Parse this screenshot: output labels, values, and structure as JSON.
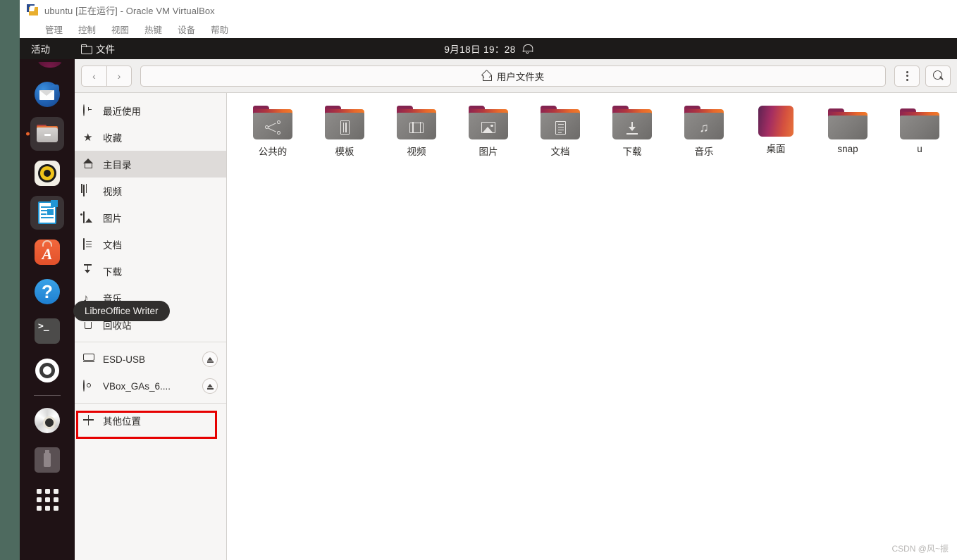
{
  "host": {
    "window_title": "ubuntu [正在运行] - Oracle VM VirtualBox",
    "menus": [
      "管理",
      "控制",
      "视图",
      "热键",
      "设备",
      "帮助"
    ]
  },
  "panel": {
    "activities": "活动",
    "app_name": "文件",
    "clock": "9月18日  19：28",
    "folder_icon": "folder-icon",
    "bell_icon": "bell-icon"
  },
  "dock": {
    "items": [
      {
        "name": "thunderbird",
        "label": "Thunderbird 邮件",
        "running": false
      },
      {
        "name": "files",
        "label": "文件",
        "running": true
      },
      {
        "name": "rhythmbox",
        "label": "Rhythmbox",
        "running": false
      },
      {
        "name": "libreoffice-writer",
        "label": "LibreOffice Writer",
        "running": false
      },
      {
        "name": "ubuntu-software",
        "label": "Ubuntu 软件",
        "running": false
      },
      {
        "name": "help",
        "label": "帮助",
        "running": false
      },
      {
        "name": "terminal",
        "label": "终端",
        "running": false
      },
      {
        "name": "settings",
        "label": "设置",
        "running": false
      },
      {
        "name": "cdrom",
        "label": "VBox_GAs_6....",
        "running": false
      },
      {
        "name": "usb-drive",
        "label": "ESD-USB",
        "running": false
      },
      {
        "name": "show-applications",
        "label": "显示应用程序",
        "running": false
      }
    ]
  },
  "tooltip": {
    "text": "LibreOffice Writer"
  },
  "headerbar": {
    "back_label": "‹",
    "forward_label": "›",
    "path_label": "用户文件夹",
    "home_icon": "home-icon",
    "menu_icon": "kebab-menu-icon",
    "search_icon": "search-icon"
  },
  "sidebar": {
    "groups": [
      {
        "items": [
          {
            "label": "最近使用",
            "icon": "clock-icon",
            "selected": false,
            "eject": false
          },
          {
            "label": "收藏",
            "icon": "star-icon",
            "selected": false,
            "eject": false
          },
          {
            "label": "主目录",
            "icon": "home-icon",
            "selected": true,
            "eject": false
          },
          {
            "label": "视频",
            "icon": "film-icon",
            "selected": false,
            "eject": false
          },
          {
            "label": "图片",
            "icon": "picture-icon",
            "selected": false,
            "eject": false
          },
          {
            "label": "文档",
            "icon": "document-icon",
            "selected": false,
            "eject": false
          },
          {
            "label": "下载",
            "icon": "download-icon",
            "selected": false,
            "eject": false
          },
          {
            "label": "音乐",
            "icon": "music-note-icon",
            "selected": false,
            "eject": false
          },
          {
            "label": "回收站",
            "icon": "trash-icon",
            "selected": false,
            "eject": false
          }
        ]
      },
      {
        "items": [
          {
            "label": "ESD-USB",
            "icon": "drive-icon",
            "selected": false,
            "eject": true,
            "highlighted": true
          },
          {
            "label": "VBox_GAs_6....",
            "icon": "disc-icon",
            "selected": false,
            "eject": true
          }
        ]
      },
      {
        "items": [
          {
            "label": "其他位置",
            "icon": "plus-icon",
            "selected": false,
            "eject": false
          }
        ]
      }
    ]
  },
  "files": {
    "items": [
      {
        "label": "公共的",
        "emblem": "share-icon",
        "kind": "folder"
      },
      {
        "label": "模板",
        "emblem": "template-icon",
        "kind": "folder"
      },
      {
        "label": "视频",
        "emblem": "film-icon",
        "kind": "folder"
      },
      {
        "label": "图片",
        "emblem": "picture-icon",
        "kind": "folder"
      },
      {
        "label": "文档",
        "emblem": "document-icon",
        "kind": "folder"
      },
      {
        "label": "下载",
        "emblem": "download-icon",
        "kind": "folder"
      },
      {
        "label": "音乐",
        "emblem": "music-note-icon",
        "kind": "folder"
      },
      {
        "label": "桌面",
        "emblem": "",
        "kind": "desktop-thumb"
      },
      {
        "label": "snap",
        "emblem": "",
        "kind": "folder-plain"
      },
      {
        "label": "u",
        "emblem": "",
        "kind": "folder-plain"
      }
    ]
  },
  "watermark": {
    "text": "CSDN @风~振"
  },
  "colors": {
    "accent_orange": "#e8622a",
    "panel_dark": "#1c1a19",
    "dock_dark": "#1f1215",
    "sidebar_bg": "#f7f6f5",
    "highlight_red": "#e60000",
    "selected_row": "#dedbd9"
  }
}
